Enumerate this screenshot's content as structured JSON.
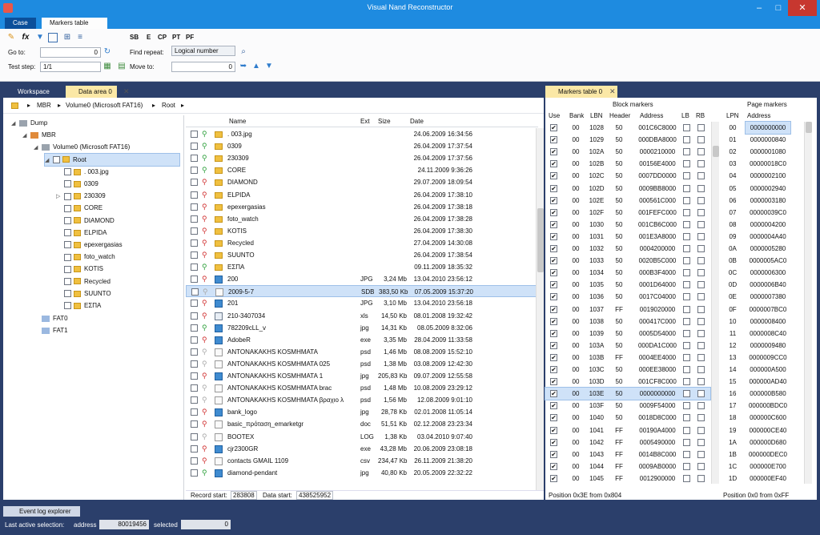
{
  "title": "Visual Nand Reconstructor",
  "titlebar_buttons": {
    "minimize": "–",
    "maximize": "□",
    "close": "✕"
  },
  "ribbon": {
    "tabs": [
      "Case",
      "Markers table"
    ],
    "tool_labels": [
      "SB",
      "E",
      "CP",
      "PT",
      "PF"
    ],
    "goto_label": "Go to:",
    "goto_value": "0",
    "find_repeat_label": "Find repeat:",
    "find_repeat_value": "Logical number",
    "test_step_label": "Test step:",
    "test_step_value": "1/1",
    "move_to_label": "Move to:",
    "move_to_value": "0"
  },
  "panel_tabs": {
    "workspace": "Workspace",
    "data_area": "Data area 0",
    "markers": "Markers table 0"
  },
  "breadcrumb": [
    "MBR",
    "Volume0 (Microsoft FAT16)",
    "Root"
  ],
  "tree": [
    {
      "label": "Dump",
      "indent": 0,
      "type": "drive"
    },
    {
      "label": "MBR",
      "indent": 1,
      "type": "mbr"
    },
    {
      "label": "Volume0 (Microsoft FAT16)",
      "indent": 2,
      "type": "vol"
    },
    {
      "label": "Root",
      "indent": 3,
      "type": "folder",
      "selected": true
    },
    {
      "label": ". 003.jpg",
      "indent": 4,
      "type": "folder"
    },
    {
      "label": "0309",
      "indent": 4,
      "type": "folder"
    },
    {
      "label": "230309",
      "indent": 4,
      "type": "folder",
      "expand": true
    },
    {
      "label": "CORE",
      "indent": 4,
      "type": "folder"
    },
    {
      "label": "DIAMOND",
      "indent": 4,
      "type": "folder"
    },
    {
      "label": "ELPIDA",
      "indent": 4,
      "type": "folder"
    },
    {
      "label": "epexergasias",
      "indent": 4,
      "type": "folder"
    },
    {
      "label": "foto_watch",
      "indent": 4,
      "type": "folder"
    },
    {
      "label": "KOTIS",
      "indent": 4,
      "type": "folder"
    },
    {
      "label": "Recycled",
      "indent": 4,
      "type": "folder"
    },
    {
      "label": "SUUNTO",
      "indent": 4,
      "type": "folder"
    },
    {
      "label": "ΕΣΠΑ",
      "indent": 4,
      "type": "folder"
    },
    {
      "label": "FAT0",
      "indent": 2,
      "type": "fat"
    },
    {
      "label": "FAT1",
      "indent": 2,
      "type": "fat"
    }
  ],
  "file_columns": [
    "Name",
    "Ext",
    "Size",
    "Date"
  ],
  "files": [
    {
      "name": ". 003.jpg",
      "ext": "",
      "size": "",
      "date": "24.06.2009 16:34:56",
      "icon": "folder",
      "pin": "g"
    },
    {
      "name": "0309",
      "ext": "",
      "size": "",
      "date": "26.04.2009 17:37:54",
      "icon": "folder",
      "pin": "g"
    },
    {
      "name": "230309",
      "ext": "",
      "size": "",
      "date": "26.04.2009 17:37:56",
      "icon": "folder",
      "pin": "g"
    },
    {
      "name": "CORE",
      "ext": "",
      "size": "",
      "date": "24.11.2009 9:36:26",
      "icon": "folder",
      "pin": "g"
    },
    {
      "name": "DIAMOND",
      "ext": "",
      "size": "",
      "date": "29.07.2009 18:09:54",
      "icon": "folder",
      "pin": "r"
    },
    {
      "name": "ELPIDA",
      "ext": "",
      "size": "",
      "date": "26.04.2009 17:38:10",
      "icon": "folder",
      "pin": "r"
    },
    {
      "name": "epexergasias",
      "ext": "",
      "size": "",
      "date": "26.04.2009 17:38:18",
      "icon": "folder",
      "pin": "r"
    },
    {
      "name": "foto_watch",
      "ext": "",
      "size": "",
      "date": "26.04.2009 17:38:28",
      "icon": "folder",
      "pin": "r"
    },
    {
      "name": "KOTIS",
      "ext": "",
      "size": "",
      "date": "26.04.2009 17:38:30",
      "icon": "folder",
      "pin": "r"
    },
    {
      "name": "Recycled",
      "ext": "",
      "size": "",
      "date": "27.04.2009 14:30:08",
      "icon": "folder",
      "pin": "r"
    },
    {
      "name": "SUUNTO",
      "ext": "",
      "size": "",
      "date": "26.04.2009 17:38:54",
      "icon": "folder",
      "pin": "r"
    },
    {
      "name": "ΕΣΠΑ",
      "ext": "",
      "size": "",
      "date": "09.11.2009 18:35:32",
      "icon": "folder",
      "pin": "g"
    },
    {
      "name": "200",
      "ext": "JPG",
      "size": "3,24 Mb",
      "date": "13.04.2010 23:56:12",
      "icon": "img",
      "pin": "r"
    },
    {
      "name": "2009-5-7",
      "ext": "SDB",
      "size": "383,50 Kb",
      "date": "07.05.2009 15:37:20",
      "icon": "doc",
      "pin": "x",
      "selected": true
    },
    {
      "name": "201",
      "ext": "JPG",
      "size": "3,10 Mb",
      "date": "13.04.2010 23:56:18",
      "icon": "img",
      "pin": "r"
    },
    {
      "name": "210-3407034",
      "ext": "xls",
      "size": "14,50 Kb",
      "date": "08.01.2008 19:32:42",
      "icon": "tab",
      "pin": "r"
    },
    {
      "name": "782209cLL_v",
      "ext": "jpg",
      "size": "14,31 Kb",
      "date": "08.05.2009 8:32:06",
      "icon": "img",
      "pin": "g"
    },
    {
      "name": "AdobeR",
      "ext": "exe",
      "size": "3,35 Mb",
      "date": "28.04.2009 11:33:58",
      "icon": "img",
      "pin": "r"
    },
    {
      "name": "ANTONAKAKHS KOSMHMATA",
      "ext": "psd",
      "size": "1,46 Mb",
      "date": "08.08.2009 15:52:10",
      "icon": "doc",
      "pin": "x"
    },
    {
      "name": "ANTONAKAKHS KOSMHMATA 025",
      "ext": "psd",
      "size": "1,38 Mb",
      "date": "03.08.2009 12:42:30",
      "icon": "doc",
      "pin": "x"
    },
    {
      "name": "ANTONAKAKHS KOSMHMATA 1",
      "ext": "jpg",
      "size": "205,83 Kb",
      "date": "09.07.2009 12:55:58",
      "icon": "img",
      "pin": "r"
    },
    {
      "name": "ANTONAKAKHS KOSMHMATA brac",
      "ext": "psd",
      "size": "1,48 Mb",
      "date": "10.08.2009 23:29:12",
      "icon": "doc",
      "pin": "x"
    },
    {
      "name": "ANTONAKAKHS KOSMHMATA βραχιο λ",
      "ext": "psd",
      "size": "1,56 Mb",
      "date": "12.08.2009 9:01:10",
      "icon": "doc",
      "pin": "x"
    },
    {
      "name": "bank_logo",
      "ext": "jpg",
      "size": "28,78 Kb",
      "date": "02.01.2008 11:05:14",
      "icon": "img",
      "pin": "r"
    },
    {
      "name": "basic_πρόταση_emarketgr",
      "ext": "doc",
      "size": "51,51 Kb",
      "date": "02.12.2008 23:23:34",
      "icon": "doc",
      "pin": "r"
    },
    {
      "name": "BOOTEX",
      "ext": "LOG",
      "size": "1,38 Kb",
      "date": "03.04.2010 9:07:40",
      "icon": "doc",
      "pin": "x"
    },
    {
      "name": "cjr2300GR",
      "ext": "exe",
      "size": "43,28 Mb",
      "date": "20.06.2009 23:08:18",
      "icon": "img",
      "pin": "r"
    },
    {
      "name": "contacts GMAIL 1109",
      "ext": "csv",
      "size": "234,47 Kb",
      "date": "26.11.2009 21:38:20",
      "icon": "doc",
      "pin": "r"
    },
    {
      "name": "diamond-pendant",
      "ext": "jpg",
      "size": "40,80 Kb",
      "date": "20.05.2009 22:32:22",
      "icon": "img",
      "pin": "g"
    }
  ],
  "record_start_label": "Record start:",
  "record_start_value": "283808",
  "data_start_label": "Data start:",
  "data_start_value": "438525952",
  "block_markers": {
    "title": "Block markers",
    "columns": [
      "Use",
      "Bank",
      "LBN",
      "Header",
      "Address",
      "LB",
      "RB"
    ],
    "rows": [
      [
        "00",
        "1028",
        "50",
        "001C6C8000"
      ],
      [
        "00",
        "1029",
        "50",
        "000DBA8000"
      ],
      [
        "00",
        "102A",
        "50",
        "0000210000"
      ],
      [
        "00",
        "102B",
        "50",
        "00156E4000"
      ],
      [
        "00",
        "102C",
        "50",
        "0007DD0000"
      ],
      [
        "00",
        "102D",
        "50",
        "0009BB8000"
      ],
      [
        "00",
        "102E",
        "50",
        "000561C000"
      ],
      [
        "00",
        "102F",
        "50",
        "001FEFC000"
      ],
      [
        "00",
        "1030",
        "50",
        "001CB6C000"
      ],
      [
        "00",
        "1031",
        "50",
        "001E3A8000"
      ],
      [
        "00",
        "1032",
        "50",
        "0004200000"
      ],
      [
        "00",
        "1033",
        "50",
        "0020B5C000"
      ],
      [
        "00",
        "1034",
        "50",
        "000B3F4000"
      ],
      [
        "00",
        "1035",
        "50",
        "0001D64000"
      ],
      [
        "00",
        "1036",
        "50",
        "0017C04000"
      ],
      [
        "00",
        "1037",
        "FF",
        "0019020000"
      ],
      [
        "00",
        "1038",
        "50",
        "000417C000"
      ],
      [
        "00",
        "1039",
        "50",
        "0005D54000"
      ],
      [
        "00",
        "103A",
        "50",
        "000DA1C000"
      ],
      [
        "00",
        "103B",
        "FF",
        "0004EE4000"
      ],
      [
        "00",
        "103C",
        "50",
        "000EE38000"
      ],
      [
        "00",
        "103D",
        "50",
        "001CF8C000"
      ],
      [
        "00",
        "103E",
        "50",
        "0000000000"
      ],
      [
        "00",
        "103F",
        "50",
        "0009F54000"
      ],
      [
        "00",
        "1040",
        "50",
        "0018D8C000"
      ],
      [
        "00",
        "1041",
        "FF",
        "00190A4000"
      ],
      [
        "00",
        "1042",
        "FF",
        "0005490000"
      ],
      [
        "00",
        "1043",
        "FF",
        "0014B8C000"
      ],
      [
        "00",
        "1044",
        "FF",
        "0009AB0000"
      ],
      [
        "00",
        "1045",
        "FF",
        "0012900000"
      ]
    ],
    "selected_index": 22,
    "footer": "Position 0x3E from 0x804"
  },
  "page_markers": {
    "title": "Page markers",
    "columns": [
      "LPN",
      "Address"
    ],
    "rows": [
      [
        "00",
        "0000000000"
      ],
      [
        "01",
        "0000000840"
      ],
      [
        "02",
        "0000001080"
      ],
      [
        "03",
        "00000018C0"
      ],
      [
        "04",
        "0000002100"
      ],
      [
        "05",
        "0000002940"
      ],
      [
        "06",
        "0000003180"
      ],
      [
        "07",
        "00000039C0"
      ],
      [
        "08",
        "0000004200"
      ],
      [
        "09",
        "0000004A40"
      ],
      [
        "0A",
        "0000005280"
      ],
      [
        "0B",
        "0000005AC0"
      ],
      [
        "0C",
        "0000006300"
      ],
      [
        "0D",
        "0000006B40"
      ],
      [
        "0E",
        "0000007380"
      ],
      [
        "0F",
        "0000007BC0"
      ],
      [
        "10",
        "0000008400"
      ],
      [
        "11",
        "0000008C40"
      ],
      [
        "12",
        "0000009480"
      ],
      [
        "13",
        "0000009CC0"
      ],
      [
        "14",
        "000000A500"
      ],
      [
        "15",
        "000000AD40"
      ],
      [
        "16",
        "000000B580"
      ],
      [
        "17",
        "000000BDC0"
      ],
      [
        "18",
        "000000C600"
      ],
      [
        "19",
        "000000CE40"
      ],
      [
        "1A",
        "000000D680"
      ],
      [
        "1B",
        "000000DEC0"
      ],
      [
        "1C",
        "000000E700"
      ],
      [
        "1D",
        "000000EF40"
      ]
    ],
    "footer": "Position 0x0 from 0xFF"
  },
  "event_log_tab": "Event log explorer",
  "statusbar": {
    "selection_label": "Last active selection:",
    "address_label": "address",
    "address_value": "80019456",
    "selected_label": "selected",
    "selected_value": "0"
  }
}
